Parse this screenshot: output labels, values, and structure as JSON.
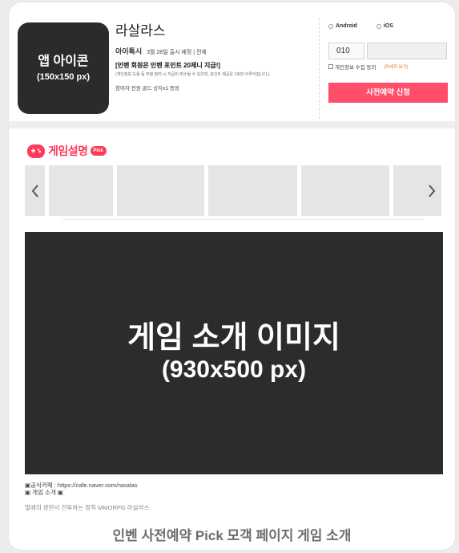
{
  "app": {
    "icon_title": "앱 아이콘",
    "icon_size": "(150x150 px)",
    "name": "라살라스",
    "publisher": "아이톡시",
    "release_info": "3월 28일 출시 예정 | 전체",
    "promo": "[인벤 회원은 인벤 포인트 20제니 지급!]",
    "promo_note": "(개인정보 도용 등 부정 참여 시 지급이 취소될 수 있으며, 포인트 제공은 1회만 이루어집니다.)",
    "reward": "참여자 전원 골드 상자x1 증정"
  },
  "form": {
    "os_options": [
      "Android",
      "iOS"
    ],
    "phone_prefix": "010",
    "consent_label": "개인정보 수집 동의",
    "consent_more": "[자세히 보기]",
    "submit_label": "사전예약 신청"
  },
  "game_section": {
    "logo_text": "게임설명",
    "pick_badge": "Pick",
    "thumb_count": 5,
    "intro_title": "게임 소개 이미지",
    "intro_size": "(930x500 px)",
    "desc_lines": [
      "▣공식카페 : https://cafe.naver.com/rasalas",
      "▣ 게임 소개 ▣",
      "멀에의 광란이 전투하는 정칙 MMORPG 라살라스"
    ]
  },
  "caption": "인벤 사전예약 Pick 모객 페이지 게임 소개",
  "colors": {
    "accent": "#ff4d6a",
    "brand_red": "#ff3b5c",
    "dark_placeholder": "#2c2c2c"
  },
  "icons": {
    "prev": "chevron-left-icon",
    "next": "chevron-right-icon",
    "logo": "gamepad-icon"
  }
}
